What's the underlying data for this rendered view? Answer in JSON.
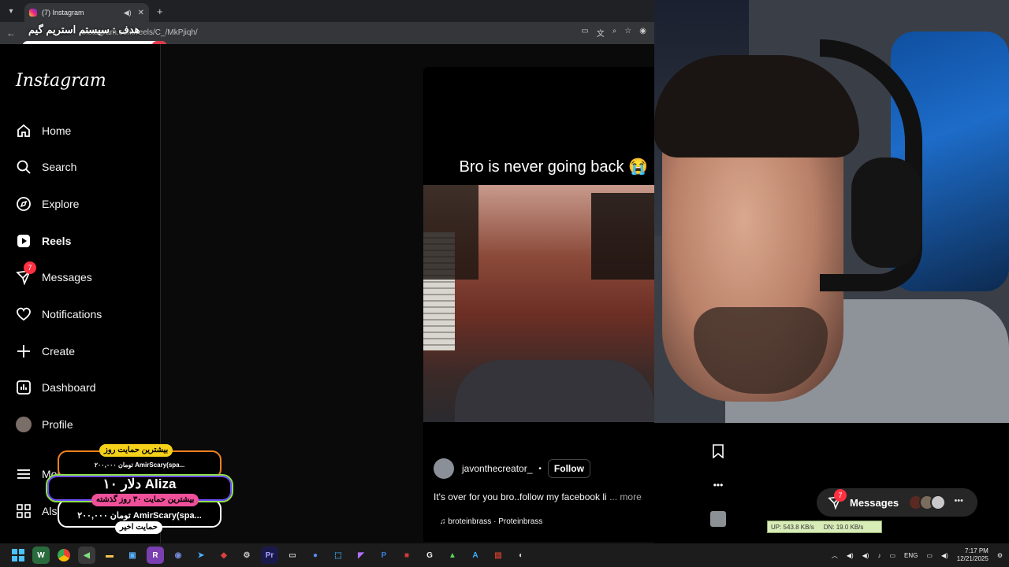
{
  "browser": {
    "tab_title": "(7) Instagram",
    "url": "instagram.com/reels/C_/MkPjiqh/",
    "new_tab": "+",
    "tab_close": "✕",
    "goal_overlay": "هدف : سیستم استریم گیم",
    "goal_progress_label": "٪۲",
    "goal_progress": 0.02
  },
  "sidebar": {
    "logo": "Instagram",
    "items": [
      {
        "label": "Home",
        "icon": "home-icon"
      },
      {
        "label": "Search",
        "icon": "search-icon"
      },
      {
        "label": "Explore",
        "icon": "explore-icon"
      },
      {
        "label": "Reels",
        "icon": "reels-icon"
      },
      {
        "label": "Messages",
        "icon": "messages-icon",
        "badge": "7"
      },
      {
        "label": "Notifications",
        "icon": "heart-icon"
      },
      {
        "label": "Create",
        "icon": "plus-icon"
      },
      {
        "label": "Dashboard",
        "icon": "dashboard-icon"
      },
      {
        "label": "Profile",
        "icon": "avatar"
      },
      {
        "label": "More",
        "icon": "menu-icon"
      },
      {
        "label": "Also from Meta",
        "icon": "apps-icon"
      }
    ]
  },
  "reel": {
    "caption": "Bro is never going back 😭",
    "author": "javonthecreator_",
    "follow_label": "Follow",
    "description": "It's over for you bro..follow my facebook li",
    "more_label": "... more",
    "music": "♫ broteinbrass · Proteinbrass"
  },
  "messages_pill": {
    "label": "Messages",
    "badge": "7"
  },
  "netmon": {
    "up": "UP: 543.8 KB/s",
    "down": "DN: 19.0 KB/s"
  },
  "donation": {
    "top_tag": "بیشترین حمایت روز",
    "top_line": "۲۰۰,۰۰۰ تومان  AmirScary(spa...",
    "mid_big": "۱۰ دلار  Aliza",
    "mid_tag": "بیشترین حمایت ۳۰ روز گذشته",
    "bot_line": "۲۰۰,۰۰۰ تومان  AmirScary(spa...",
    "bot_tag": "حمایت اخیر"
  },
  "taskbar": {
    "lang": "ENG",
    "time": "7:17 PM",
    "date": "12/21/2025"
  },
  "colors": {
    "accent_red": "#ff3040",
    "bg": "#000000",
    "chrome": "#35363a"
  }
}
